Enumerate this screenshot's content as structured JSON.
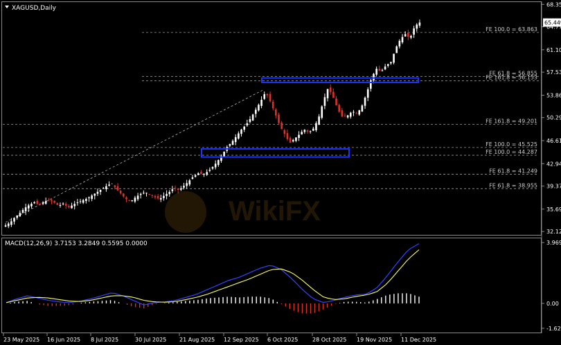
{
  "header": {
    "symbol_label": "XAGUSD,Daily",
    "macd_label": "MACD(12,26,9) 3.7153 3.2849 0.5595 0.0000"
  },
  "colors": {
    "background": "#000000",
    "bull_candle": "#ffffff",
    "bear_candle": "#e0302a",
    "zone": "#1a33ff",
    "macd_signal": "#ffff66",
    "macd_line": "#3344ff",
    "macd_hist_pos": "#ffffff",
    "macd_hist_neg": "#e0302a",
    "price_tag": "#ffffff"
  },
  "chart_data": [
    {
      "type": "candlestick",
      "title": "XAGUSD,Daily",
      "y_ticks": [
        "68.350",
        "64.770",
        "61.105",
        "57.535",
        "53.860",
        "50.290",
        "46.615",
        "42.940",
        "39.370",
        "35.695",
        "32.125"
      ],
      "y_tick_values": [
        68.35,
        64.77,
        61.105,
        57.535,
        53.86,
        50.29,
        46.615,
        42.94,
        39.37,
        35.695,
        32.125
      ],
      "ylim": [
        31.7,
        68.6
      ],
      "x_ticks": [
        "23 May 2025",
        "16 Jun 2025",
        "8 Jul 2025",
        "30 Jul 2025",
        "21 Aug 2025",
        "12 Sep 2025",
        "6 Oct 2025",
        "28 Oct 2025",
        "19 Nov 2025",
        "11 Dec 2025"
      ],
      "current_price": "65.449",
      "fe_levels": [
        {
          "label": "FE 100.0 = 63.863",
          "value": 63.863
        },
        {
          "label": "FE 61.8 = 56.855",
          "value": 56.855
        },
        {
          "label": "FE 161.8 = 56.153",
          "value": 56.153
        },
        {
          "label": "FE 161.8 = 49.201",
          "value": 49.201
        },
        {
          "label": "FE 100.0 = 45.525",
          "value": 45.525
        },
        {
          "label": "FE 100.0 = 44.287",
          "value": 44.287
        },
        {
          "label": "FE 61.8 = 41.249",
          "value": 41.249
        },
        {
          "label": "FE 61.8 = 38.955",
          "value": 38.955
        }
      ],
      "zones": [
        {
          "low": 55.9,
          "high": 56.6
        },
        {
          "low": 44.0,
          "high": 45.3
        }
      ],
      "trendline": {
        "from": 33.6,
        "to": 54.8
      },
      "candle_path": [
        33.1,
        33.6,
        34.4,
        35.1,
        35.9,
        36.4,
        36.8,
        36.3,
        36.9,
        37.1,
        36.8,
        36.2,
        36.6,
        35.9,
        36.4,
        36.8,
        37.1,
        37.4,
        37.9,
        38.4,
        38.9,
        39.4,
        39.8,
        38.9,
        38.1,
        37.3,
        36.9,
        37.6,
        38.1,
        38.4,
        38.0,
        37.6,
        37.3,
        37.9,
        38.4,
        39.1,
        38.7,
        39.4,
        40.1,
        40.9,
        41.4,
        41.2,
        41.7,
        42.4,
        43.3,
        44.4,
        45.6,
        46.4,
        47.4,
        48.4,
        49.2,
        50.3,
        51.6,
        52.9,
        54.4,
        52.8,
        50.9,
        48.9,
        47.6,
        46.2,
        46.9,
        47.6,
        48.4,
        47.9,
        48.6,
        50.2,
        52.9,
        55.1,
        53.6,
        51.6,
        50.3,
        50.6,
        51.3,
        50.9,
        52.1,
        54.2,
        56.6,
        58.1,
        57.6,
        58.6,
        59.1,
        61.3,
        62.8,
        63.6,
        62.9,
        64.9,
        65.45
      ],
      "candle_count": 145
    },
    {
      "type": "macd",
      "title": "MACD(12,26,9) 3.7153 3.2849 0.5595 0.0000",
      "y_ticks": [
        "3.9695",
        "0.00",
        "-1.622"
      ],
      "y_tick_values": [
        3.9695,
        0.0,
        -1.622
      ],
      "ylim": [
        -1.9,
        4.2
      ],
      "macd_path": [
        0.05,
        0.3,
        0.5,
        0.35,
        0.2,
        0.1,
        0.05,
        0.15,
        0.3,
        0.5,
        0.7,
        0.5,
        0.2,
        -0.1,
        0.05,
        0.1,
        0.2,
        0.4,
        0.6,
        0.9,
        1.2,
        1.5,
        1.7,
        2.0,
        2.3,
        2.5,
        2.2,
        1.6,
        0.9,
        0.3,
        0.05,
        0.2,
        0.4,
        0.55,
        0.6,
        1.0,
        1.8,
        2.7,
        3.5,
        3.9
      ],
      "signal_path": [
        0.05,
        0.2,
        0.35,
        0.4,
        0.35,
        0.25,
        0.15,
        0.12,
        0.2,
        0.35,
        0.5,
        0.5,
        0.4,
        0.2,
        0.1,
        0.08,
        0.12,
        0.25,
        0.4,
        0.6,
        0.85,
        1.1,
        1.35,
        1.6,
        1.9,
        2.2,
        2.25,
        2.0,
        1.5,
        0.9,
        0.4,
        0.25,
        0.3,
        0.45,
        0.55,
        0.75,
        1.3,
        2.1,
        2.9,
        3.5
      ]
    }
  ],
  "x_axis_labels": [
    "23 May 2025",
    "16 Jun 2025",
    "8 Jul 2025",
    "30 Jul 2025",
    "21 Aug 2025",
    "12 Sep 2025",
    "6 Oct 2025",
    "28 Oct 2025",
    "19 Nov 2025",
    "11 Dec 2025"
  ]
}
